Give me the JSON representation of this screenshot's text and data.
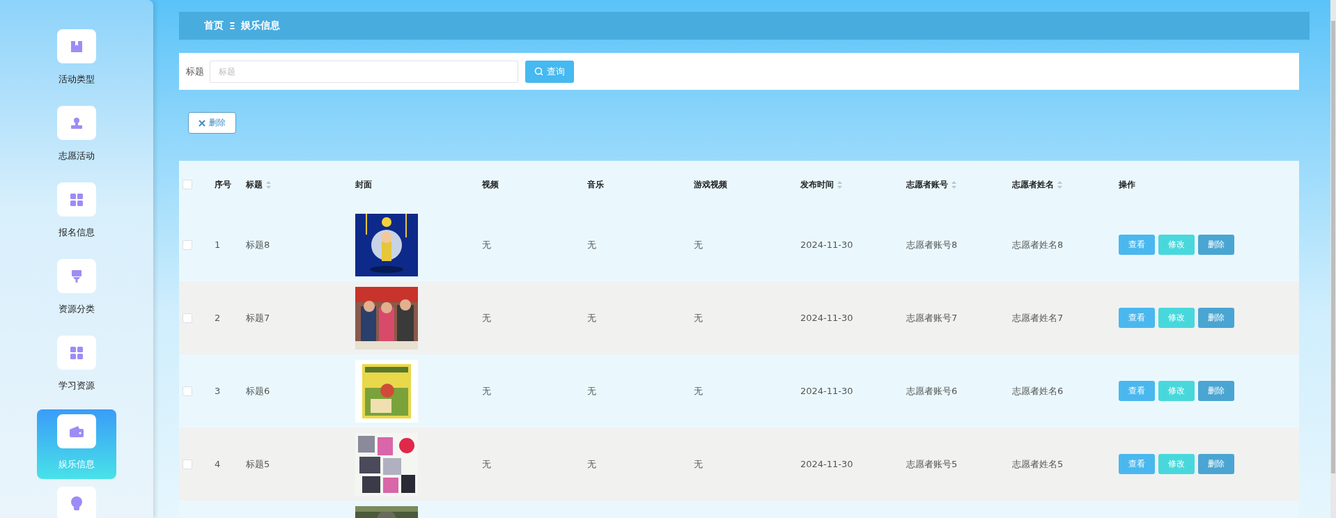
{
  "sidebar": {
    "items": [
      {
        "label": "活动类型",
        "kind": "bookmark",
        "selected": false
      },
      {
        "label": "志愿活动",
        "kind": "stamp",
        "selected": false
      },
      {
        "label": "报名信息",
        "kind": "grid",
        "selected": false
      },
      {
        "label": "资源分类",
        "kind": "brush",
        "selected": false
      },
      {
        "label": "学习资源",
        "kind": "grid",
        "selected": false
      },
      {
        "label": "娱乐信息",
        "kind": "wallet",
        "selected": true
      },
      {
        "kind": "bulb",
        "selected": false
      }
    ]
  },
  "breadcrumb": {
    "home": "首页",
    "separator": "Ξ",
    "current": "娱乐信息"
  },
  "search": {
    "label": "标题",
    "placeholder": "标题",
    "button": "查询"
  },
  "toolbar": {
    "delete_button": "删除"
  },
  "table": {
    "select_all": {
      "checked": false
    },
    "columns": [
      {
        "label": "序号",
        "sortable": false
      },
      {
        "label": "标题",
        "sortable": true
      },
      {
        "label": "封面",
        "sortable": false
      },
      {
        "label": "视频",
        "sortable": false
      },
      {
        "label": "音乐",
        "sortable": false
      },
      {
        "label": "游戏视频",
        "sortable": false
      },
      {
        "label": "发布时间",
        "sortable": true
      },
      {
        "label": "志愿者账号",
        "sortable": true
      },
      {
        "label": "志愿者姓名",
        "sortable": true
      },
      {
        "label": "操作",
        "sortable": false
      }
    ],
    "rows": [
      {
        "checked": false,
        "index": "1",
        "title": "标题8",
        "cover": {
          "kind": "picture"
        },
        "video": "无",
        "music": "无",
        "game_video": "无",
        "date": "2024-11-30",
        "account": "志愿者账号8",
        "name": "志愿者姓名8",
        "actions": [
          "查看",
          "修改",
          "删除"
        ]
      },
      {
        "checked": false,
        "index": "2",
        "title": "标题7",
        "cover": {
          "kind": "picture"
        },
        "video": "无",
        "music": "无",
        "game_video": "无",
        "date": "2024-11-30",
        "account": "志愿者账号7",
        "name": "志愿者姓名7",
        "actions": [
          "查看",
          "修改",
          "删除"
        ]
      },
      {
        "checked": false,
        "index": "3",
        "title": "标题6",
        "cover": {
          "kind": "picture"
        },
        "video": "无",
        "music": "无",
        "game_video": "无",
        "date": "2024-11-30",
        "account": "志愿者账号6",
        "name": "志愿者姓名6",
        "actions": [
          "查看",
          "修改",
          "删除"
        ]
      },
      {
        "checked": false,
        "index": "4",
        "title": "标题5",
        "cover": {
          "kind": "picture"
        },
        "video": "无",
        "music": "无",
        "game_video": "无",
        "date": "2024-11-30",
        "account": "志愿者账号5",
        "name": "志愿者姓名5",
        "actions": [
          "查看",
          "修改",
          "删除"
        ]
      },
      {
        "cover": {
          "kind": "picture"
        }
      }
    ]
  }
}
